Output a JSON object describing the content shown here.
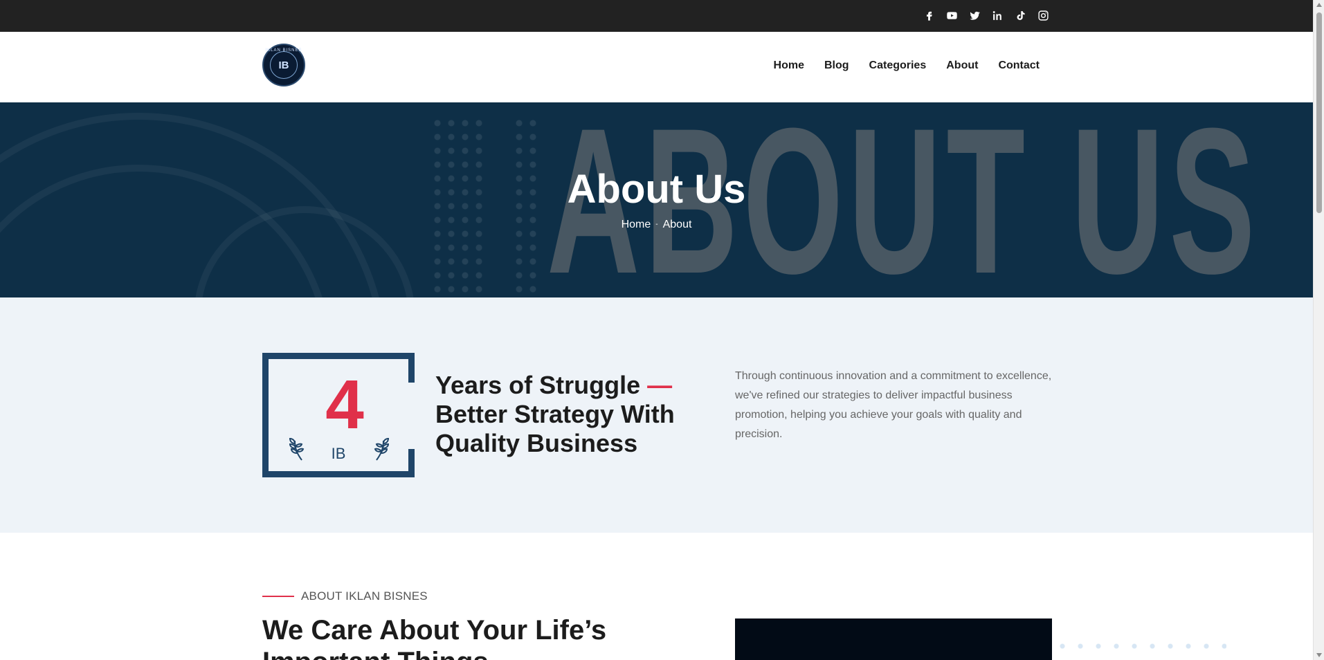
{
  "topbar": {
    "social": [
      {
        "icon": "facebook-icon"
      },
      {
        "icon": "youtube-icon"
      },
      {
        "icon": "twitter-icon"
      },
      {
        "icon": "linkedin-icon"
      },
      {
        "icon": "tiktok-icon"
      },
      {
        "icon": "instagram-icon"
      }
    ]
  },
  "header": {
    "logo": {
      "ring_text": "IKLAN BISNES",
      "mark": "IB"
    },
    "nav": [
      "Home",
      "Blog",
      "Categories",
      "About",
      "Contact"
    ]
  },
  "hero": {
    "background_text": "ABOUT US",
    "title": "About Us",
    "breadcrumb": {
      "home": "Home",
      "separator": "-",
      "current": "About"
    }
  },
  "stats": {
    "number": "4",
    "label": "IB",
    "title_line1": "Years of Struggle",
    "title_dash": "—",
    "title_rest": "Better Strategy With Quality Business",
    "description": "Through continuous innovation and a commitment to excellence, we've refined our strategies to deliver impactful business promotion, helping you achieve your goals with quality and precision."
  },
  "about": {
    "eyebrow": "ABOUT IKLAN BISNES",
    "title": "We Care About Your Life’s Important Things"
  },
  "colors": {
    "topbar": "#222222",
    "hero_bg": "#0e2f47",
    "accent": "#e0304a",
    "navy": "#1f4569",
    "stats_bg": "#eef3f8"
  }
}
